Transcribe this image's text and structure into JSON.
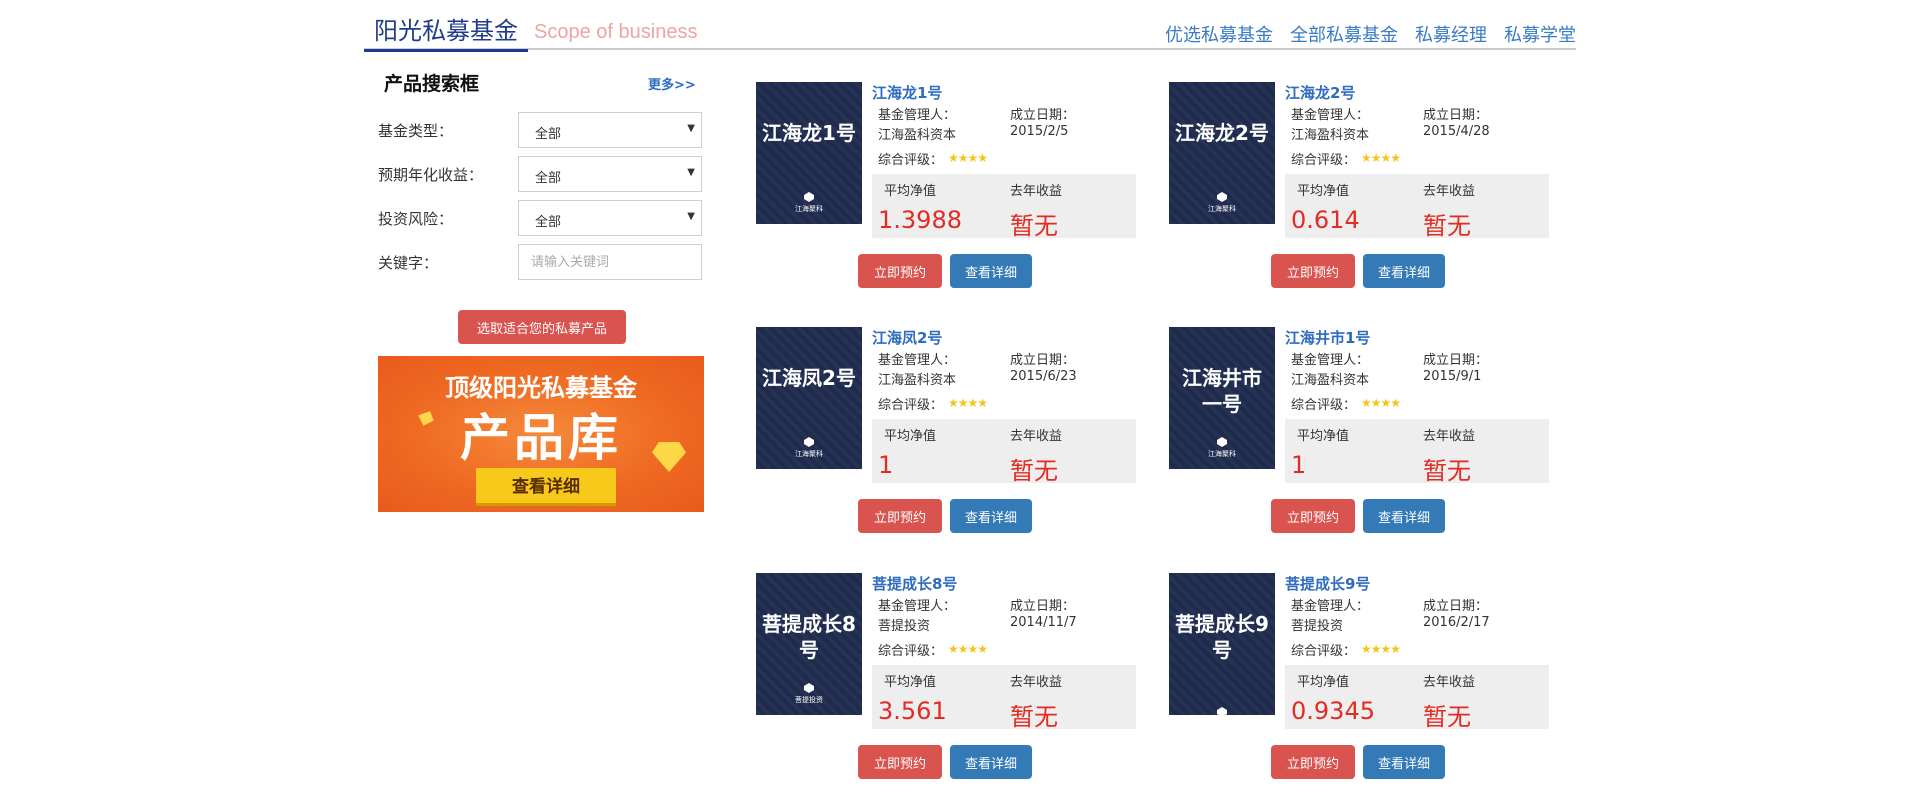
{
  "header": {
    "brand_cn": "阳光私募基金",
    "brand_en": "Scope of business",
    "nav": [
      "优选私募基金",
      "全部私募基金",
      "私募经理",
      "私募学堂"
    ]
  },
  "search": {
    "title": "产品搜索框",
    "more": "更多>>",
    "fund_type_label": "基金类型：",
    "fund_type_value": "全部",
    "yield_label": "预期年化收益：",
    "yield_value": "全部",
    "risk_label": "投资风险：",
    "risk_value": "全部",
    "keyword_label": "关键字：",
    "keyword_placeholder": "请输入关键词",
    "filter_button": "选取适合您的私募产品"
  },
  "banner": {
    "title": "顶级阳光私募基金",
    "big": "产品库",
    "button": "查看详细"
  },
  "labels": {
    "manager": "基金管理人：",
    "date": "成立日期：",
    "rating": "综合评级：",
    "avg_nav": "平均净值",
    "last_year": "去年收益",
    "reserve": "立即预约",
    "detail": "查看详细",
    "stars": "★★★★"
  },
  "colors": {
    "accent_blue": "#337ab7",
    "accent_red": "#d9534f",
    "value_red": "#e22b22",
    "cover_bg": "#1e2b4d"
  },
  "products": [
    {
      "name": "江海龙1号",
      "cover": "江海龙1号",
      "logo": "江海聚科",
      "manager": "江海盈科资本",
      "date": "2015/2/5",
      "nav": "1.3988",
      "last_year": "暂无"
    },
    {
      "name": "江海龙2号",
      "cover": "江海龙2号",
      "logo": "江海聚科",
      "manager": "江海盈科资本",
      "date": "2015/4/28",
      "nav": "0.614",
      "last_year": "暂无"
    },
    {
      "name": "江海凤2号",
      "cover": "江海凤2号",
      "logo": "江海聚科",
      "manager": "江海盈科资本",
      "date": "2015/6/23",
      "nav": "1",
      "last_year": "暂无"
    },
    {
      "name": "江海井市1号",
      "cover": "江海井市一号",
      "logo": "江海聚科",
      "manager": "江海盈科资本",
      "date": "2015/9/1",
      "nav": "1",
      "last_year": "暂无"
    },
    {
      "name": "菩提成长8号",
      "cover": "菩提成长8号",
      "logo": "菩提投资",
      "manager": "菩提投资",
      "date": "2014/11/7",
      "nav": "3.561",
      "last_year": "暂无"
    },
    {
      "name": "菩提成长9号",
      "cover": "菩提成长9号",
      "logo": "",
      "manager": "菩提投资",
      "date": "2016/2/17",
      "nav": "0.9345",
      "last_year": "暂无"
    }
  ]
}
